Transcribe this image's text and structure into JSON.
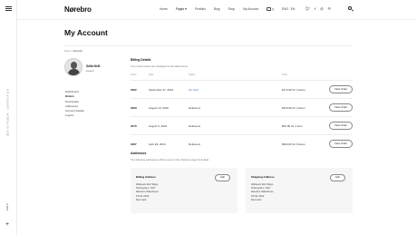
{
  "sidebar": {
    "vertical_text": "Get in touch · Contact us",
    "cart_label": "Cart 0",
    "plus_label": "+"
  },
  "header": {
    "logo": "Nørebro",
    "nav": [
      "Home",
      "Pages",
      "Portfolio",
      "Blog",
      "Shop",
      "My Account"
    ],
    "cart": "0",
    "lang": "ENG",
    "lang_alt": "EN",
    "socials": [
      "twitter-icon",
      "facebook-icon",
      "instagram-icon",
      "pinterest-icon"
    ]
  },
  "page": {
    "title": "My Account",
    "breadcrumb_home": "Home",
    "breadcrumb_sep": "/",
    "breadcrumb_current": "Account"
  },
  "user": {
    "name": "Sofia Nelli",
    "logout": "Logout"
  },
  "menu": [
    "Dashboard",
    "Orders",
    "Downloads",
    "Addresses",
    "Account Details",
    "Logout"
  ],
  "orders": {
    "title": "Billing Details",
    "subtitle": "Your recent orders are displayed in the table below.",
    "headers": {
      "order": "Order",
      "date": "Date",
      "status": "Status",
      "total": "Total"
    },
    "rows": [
      {
        "number": "#062",
        "date": "September 27, 2016",
        "status": "On hold",
        "total": "$174.00 for 4 items",
        "action": "View Order"
      },
      {
        "number": "#063",
        "date": "August 13, 2016",
        "status": "Delivered",
        "total": "$234.00 for 4 items",
        "action": "View Order"
      },
      {
        "number": "#070",
        "date": "August 5, 2016",
        "status": "Delivered",
        "total": "$52.00 for 1 item",
        "action": "View Order"
      },
      {
        "number": "#067",
        "date": "April 29, 2016",
        "status": "Delivered",
        "total": "$364.00 for 6 items",
        "action": "View Order"
      }
    ]
  },
  "addresses": {
    "title": "Addresses",
    "subtitle": "The following addresses will be used on the checkout page by default.",
    "cards": [
      {
        "title": "Billing Address",
        "edit": "Edit",
        "lines": [
          "Wabeant Elm Ways",
          "Nottingham, NG7",
          "Raindon Waterheen",
          "07111 2402",
          "Denmark"
        ]
      },
      {
        "title": "Shipping Address",
        "edit": "Edit",
        "lines": [
          "Wabeant Elm Ways",
          "Nottingham, NG7",
          "Raindon Waterheen",
          "07111 2402",
          "Denmark"
        ]
      }
    ]
  },
  "colors": {
    "accent": "#3a6fb5",
    "card_bg": "#f6f6f6"
  }
}
